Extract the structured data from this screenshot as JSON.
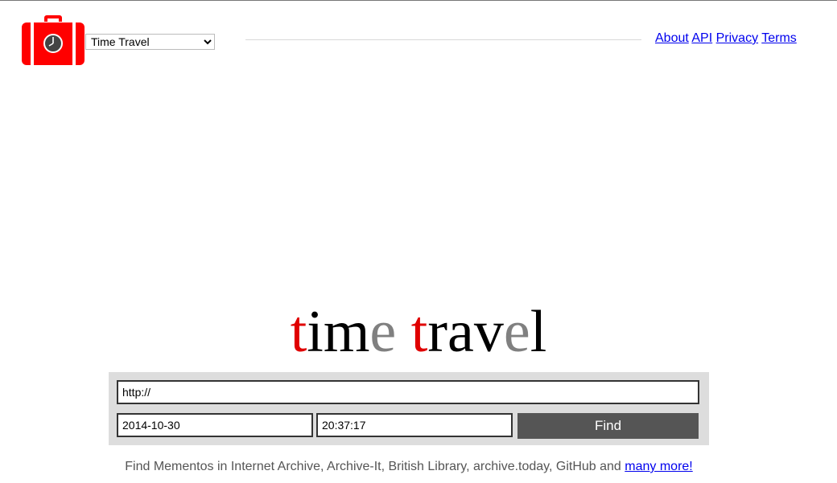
{
  "header": {
    "site_select": {
      "selected": "Time Travel",
      "options": [
        "Time Travel"
      ]
    },
    "nav": {
      "about": "About",
      "api": "API",
      "privacy": "Privacy",
      "terms": "Terms"
    }
  },
  "brand": {
    "chars": [
      {
        "c": "t",
        "color": "red"
      },
      {
        "c": "i",
        "color": "black"
      },
      {
        "c": "m",
        "color": "black"
      },
      {
        "c": "e",
        "color": "grey"
      },
      {
        "c": " ",
        "color": "black"
      },
      {
        "c": "t",
        "color": "red"
      },
      {
        "c": "r",
        "color": "black"
      },
      {
        "c": "a",
        "color": "black"
      },
      {
        "c": "v",
        "color": "black"
      },
      {
        "c": "e",
        "color": "grey"
      },
      {
        "c": "l",
        "color": "black"
      }
    ]
  },
  "search": {
    "url_value": "http://",
    "date_value": "2014-10-30",
    "time_value": "20:37:17",
    "find_label": "Find"
  },
  "footer": {
    "text": "Find Mementos in Internet Archive, Archive-It, British Library, archive.today, GitHub and ",
    "link_text": "many more!"
  },
  "colors": {
    "logo_red": "#ff0000",
    "button_bg": "#555555",
    "search_bg": "#dddddd",
    "brand_red": "#e00000",
    "brand_grey": "#808080"
  }
}
